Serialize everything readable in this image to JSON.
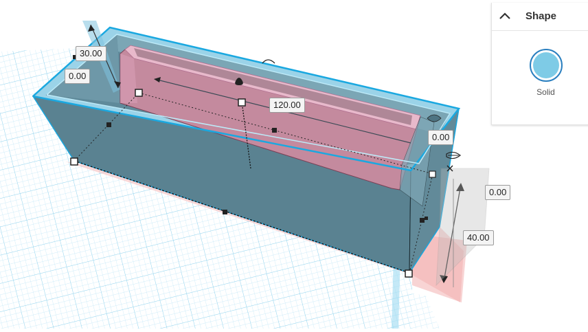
{
  "panel": {
    "title": "Shape",
    "solid_label": "Solid",
    "solid_color": "#7ecbe6",
    "collapse_icon": "chevron-up-icon"
  },
  "dimensions": {
    "height_value": "30.00",
    "elevation_value": "0.00",
    "length_value": "120.00",
    "right_offset_value": "0.00",
    "side_offset_value": "0.00",
    "width_value": "40.00"
  },
  "colors": {
    "box_front": "#5a8291",
    "box_rim": "#9bd3e8",
    "selection_outline": "#1aa8e0",
    "inner_hole": "#c48a9e",
    "grid_line": "#bfe6f7",
    "shadow": "#f4b6b6"
  },
  "icons": [
    "chevron-up-icon",
    "lightbulb-icon",
    "rotate-handle-icon",
    "close-icon"
  ]
}
